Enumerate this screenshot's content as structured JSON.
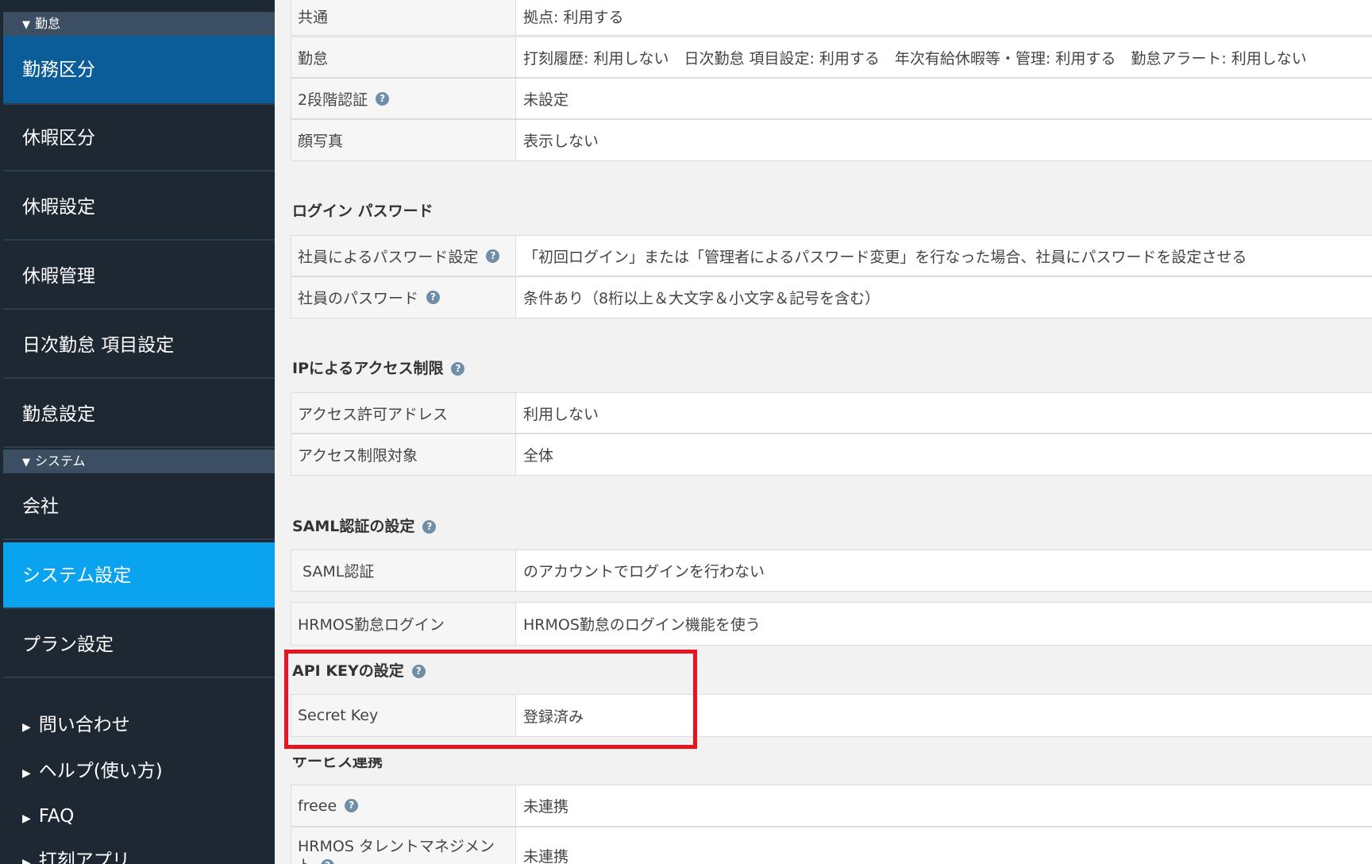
{
  "sidebar": {
    "section_attendance": "勤怠",
    "section_system": "システム",
    "items": [
      {
        "label": "勤務区分"
      },
      {
        "label": "休暇区分"
      },
      {
        "label": "休暇設定"
      },
      {
        "label": "休暇管理"
      },
      {
        "label": "日次勤怠 項目設定"
      },
      {
        "label": "勤怠設定"
      },
      {
        "label": "会社"
      },
      {
        "label": "システム設定"
      },
      {
        "label": "プラン設定"
      }
    ],
    "links": [
      {
        "label": "問い合わせ"
      },
      {
        "label": "ヘルプ(使い方)"
      },
      {
        "label": "FAQ"
      },
      {
        "label": "打刻アプリ"
      }
    ]
  },
  "main": {
    "rows_top": [
      {
        "key": "共通",
        "value": "拠点: 利用する"
      },
      {
        "key": "勤怠",
        "value": "打刻履歴: 利用しない　日次勤怠 項目設定: 利用する　年次有給休暇等・管理: 利用する　勤怠アラート: 利用しない"
      },
      {
        "key": "2段階認証",
        "value": "未設定"
      },
      {
        "key": "顔写真",
        "value": "表示しない"
      }
    ],
    "login_password": {
      "title": "ログイン パスワード",
      "rows": [
        {
          "key": "社員によるパスワード設定",
          "value": "「初回ログイン」または「管理者によるパスワード変更」を行なった場合、社員にパスワードを設定させる"
        },
        {
          "key": "社員のパスワード",
          "value": "条件あり（8桁以上＆大文字＆小文字＆記号を含む）"
        }
      ]
    },
    "ip_access": {
      "title": "IPによるアクセス制限",
      "rows": [
        {
          "key": "アクセス許可アドレス",
          "value": "利用しない"
        },
        {
          "key": "アクセス制限対象",
          "value": "全体"
        }
      ]
    },
    "saml": {
      "title": "SAML認証の設定",
      "rows": [
        {
          "key": "SAML認証",
          "value": "のアカウントでログインを行わない"
        },
        {
          "key": "HRMOS勤怠ログイン",
          "value": "HRMOS勤怠のログイン機能を使う"
        }
      ]
    },
    "api_key": {
      "title": "API KEYの設定",
      "rows": [
        {
          "key": "Secret Key",
          "value": "登録済み"
        }
      ]
    },
    "service": {
      "title": "サービス連携",
      "rows": [
        {
          "key": "freee",
          "value": "未連携"
        },
        {
          "key": "HRMOS タレントマネジメント",
          "value": "未連携"
        }
      ]
    },
    "help_icon_glyph": "?"
  },
  "colors": {
    "sidebar_bg": "#1e2833",
    "active_item": "#0aa3f0",
    "highlight": "#e5141e"
  }
}
